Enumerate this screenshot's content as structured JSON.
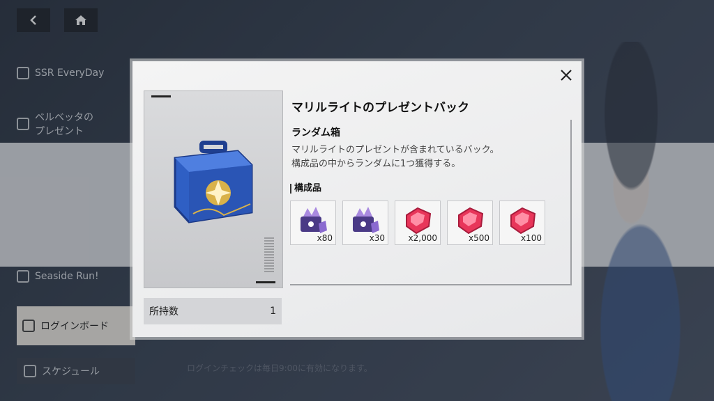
{
  "nav": {
    "back_icon": "chevron-left-icon",
    "home_icon": "home-icon"
  },
  "sidebar": {
    "items": [
      {
        "label": "SSR EveryDay"
      },
      {
        "label": "ベルベッタの\nプレゼント"
      },
      {
        "label": "Seaside Run!"
      },
      {
        "label": "ログインボード"
      },
      {
        "label": "スケジュール"
      }
    ]
  },
  "background_note": "ログインチェックは毎日9:00に有効になります。",
  "modal": {
    "title": "マリルライトのプレゼントバック",
    "item_type": "ランダム箱",
    "description": "マリルライトのプレゼントが含まれているバック。\n構成品の中からランダムに1つ獲得する。",
    "contents_label": "構成品",
    "owned_label": "所持数",
    "owned_count": "1",
    "rewards": [
      {
        "icon": "purple-crystal-chest-icon",
        "qty": "x80"
      },
      {
        "icon": "purple-crystal-chest-icon",
        "qty": "x30"
      },
      {
        "icon": "red-gem-icon",
        "qty": "x2,000"
      },
      {
        "icon": "red-gem-icon",
        "qty": "x500"
      },
      {
        "icon": "red-gem-icon",
        "qty": "x100"
      }
    ]
  },
  "colors": {
    "box_blue": "#2f5fc4",
    "gold": "#d9b24a",
    "gem_red": "#e8365a",
    "crystal_purple": "#6b4ea8"
  }
}
